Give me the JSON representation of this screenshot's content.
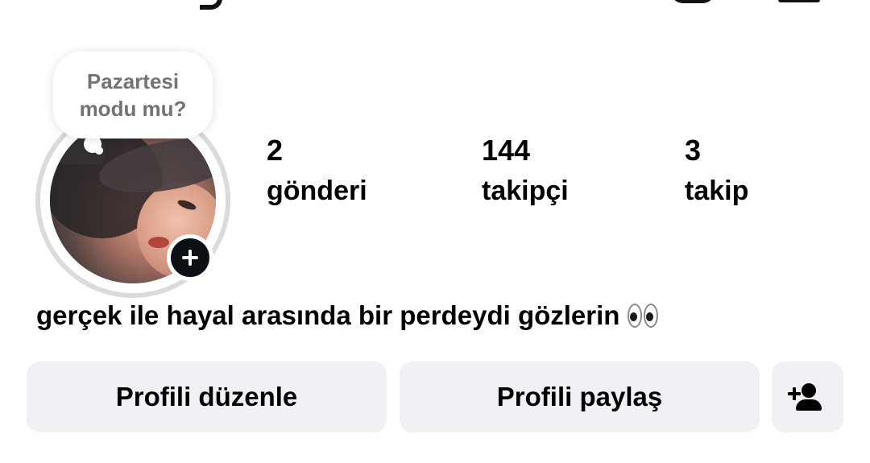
{
  "note": {
    "line1": "Pazartesi",
    "line2": "modu mu?"
  },
  "stats": {
    "posts": {
      "value": "2",
      "label": "gönderi"
    },
    "followers": {
      "value": "144",
      "label": "takipçi"
    },
    "following": {
      "value": "3",
      "label": "takip"
    }
  },
  "bio": {
    "text": "gerçek ile hayal arasında bir perdeydi gözlerin",
    "emoji_icon": "eyes-icon"
  },
  "buttons": {
    "edit_profile": "Profili düzenle",
    "share_profile": "Profili paylaş",
    "discover_people_icon": "add-person-icon"
  },
  "colors": {
    "button_bg": "#eff1f5",
    "note_text": "#737373",
    "story_ring": "#dbdbdb",
    "add_badge": "#0c1014"
  }
}
